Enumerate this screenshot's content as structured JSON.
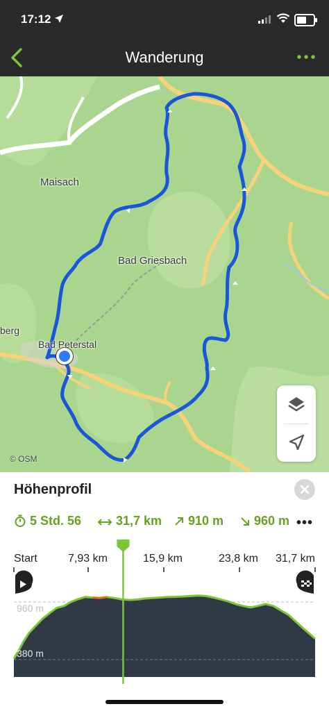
{
  "status_bar": {
    "time": "17:12"
  },
  "nav": {
    "title": "Wanderung"
  },
  "map": {
    "labels": {
      "maisach": "Maisach",
      "bad_griesbach": "Bad Griesbach",
      "bad_peterstal": "Bad Peterstal",
      "berg": "berg"
    },
    "attribution": "© OSM"
  },
  "profile_panel": {
    "title": "Höhenprofil",
    "stats": {
      "duration": "5 Std. 56",
      "distance": "31,7 km",
      "ascent": "910 m",
      "descent": "960 m"
    },
    "x_axis": [
      "Start",
      "7,93 km",
      "15,9 km",
      "23,8 km",
      "31,7 km"
    ],
    "y_labels": {
      "top": "960 m",
      "bottom": "380 m"
    }
  },
  "chart_data": {
    "type": "area",
    "title": "Höhenprofil",
    "xlabel": "",
    "ylabel": "",
    "x_unit": "km",
    "y_unit": "m",
    "xlim": [
      0,
      31.7
    ],
    "ylim": [
      380,
      960
    ],
    "x_ticks": [
      "Start",
      "7,93 km",
      "15,9 km",
      "23,8 km",
      "31,7 km"
    ],
    "y_ticks": [
      "960 m",
      "380 m"
    ],
    "current_position_km": 11.5,
    "series": [
      {
        "x": [
          0,
          0.5,
          1.0,
          1.6,
          2.3,
          3.0,
          3.8,
          4.5,
          5.3,
          6.0,
          6.8,
          7.5,
          8.3,
          9.0,
          9.8,
          10.6,
          11.4,
          12.2,
          13.0,
          13.8,
          14.6,
          15.4,
          16.2,
          17.0,
          17.8,
          18.6,
          19.4,
          20.2,
          21.0,
          21.8,
          22.6,
          23.3,
          24.1,
          24.9,
          25.7,
          26.5,
          27.3,
          28.1,
          28.9,
          29.7,
          30.5,
          31.7
        ],
        "y": [
          390,
          470,
          560,
          650,
          720,
          790,
          850,
          900,
          920,
          960,
          990,
          1010,
          1005,
          1000,
          1010,
          1000,
          985,
          980,
          985,
          995,
          1000,
          1005,
          1010,
          1012,
          1015,
          1020,
          1025,
          1020,
          1005,
          985,
          965,
          940,
          920,
          905,
          920,
          940,
          920,
          875,
          830,
          760,
          690,
          590
        ]
      }
    ]
  }
}
